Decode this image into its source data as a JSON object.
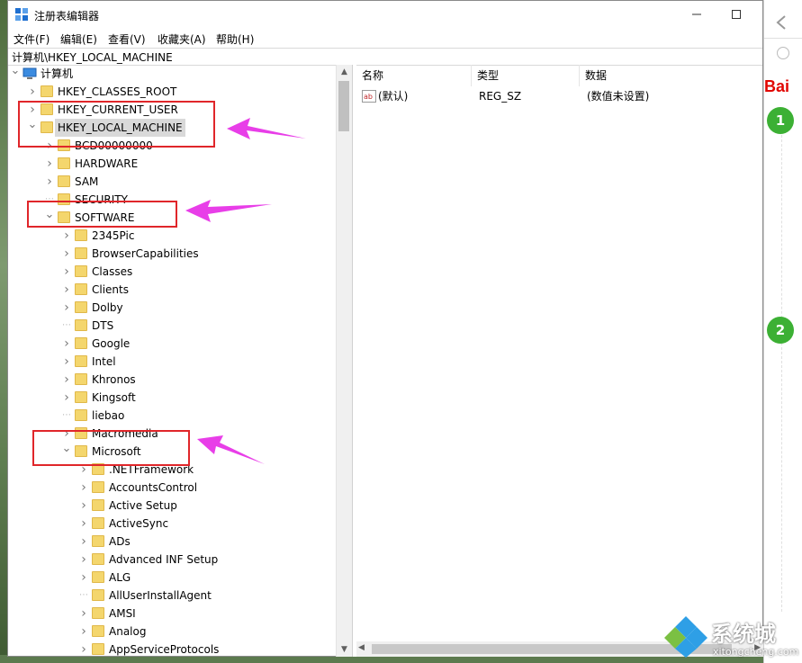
{
  "window": {
    "title": "注册表编辑器",
    "minimize_icon": "minimize-icon",
    "maximize_icon": "maximize-icon"
  },
  "menu": [
    "文件(F)",
    "编辑(E)",
    "查看(V)",
    "收藏夹(A)",
    "帮助(H)"
  ],
  "address": "计算机\\HKEY_LOCAL_MACHINE",
  "columns": {
    "name": "名称",
    "type": "类型",
    "data": "数据"
  },
  "values": [
    {
      "name": "(默认)",
      "type": "REG_SZ",
      "data": "(数值未设置)",
      "icon": "string-value-icon"
    }
  ],
  "tree": [
    {
      "label": "计算机",
      "level": 0,
      "expander": "expanded",
      "icon": "computer-icon"
    },
    {
      "label": "HKEY_CLASSES_ROOT",
      "level": 1,
      "expander": "collapsed"
    },
    {
      "label": "HKEY_CURRENT_USER",
      "level": 1,
      "expander": "collapsed"
    },
    {
      "label": "HKEY_LOCAL_MACHINE",
      "level": 1,
      "expander": "expanded",
      "selected": true
    },
    {
      "label": "BCD00000000",
      "level": 2,
      "expander": "collapsed"
    },
    {
      "label": "HARDWARE",
      "level": 2,
      "expander": "collapsed"
    },
    {
      "label": "SAM",
      "level": 2,
      "expander": "collapsed"
    },
    {
      "label": "SECURITY",
      "level": 2,
      "expander": "none"
    },
    {
      "label": "SOFTWARE",
      "level": 2,
      "expander": "expanded"
    },
    {
      "label": "2345Pic",
      "level": 3,
      "expander": "collapsed"
    },
    {
      "label": "BrowserCapabilities",
      "level": 3,
      "expander": "collapsed"
    },
    {
      "label": "Classes",
      "level": 3,
      "expander": "collapsed"
    },
    {
      "label": "Clients",
      "level": 3,
      "expander": "collapsed"
    },
    {
      "label": "Dolby",
      "level": 3,
      "expander": "collapsed"
    },
    {
      "label": "DTS",
      "level": 3,
      "expander": "none"
    },
    {
      "label": "Google",
      "level": 3,
      "expander": "collapsed"
    },
    {
      "label": "Intel",
      "level": 3,
      "expander": "collapsed"
    },
    {
      "label": "Khronos",
      "level": 3,
      "expander": "collapsed"
    },
    {
      "label": "Kingsoft",
      "level": 3,
      "expander": "collapsed"
    },
    {
      "label": "liebao",
      "level": 3,
      "expander": "none"
    },
    {
      "label": "Macromedia",
      "level": 3,
      "expander": "collapsed"
    },
    {
      "label": "Microsoft",
      "level": 3,
      "expander": "expanded"
    },
    {
      "label": ".NETFramework",
      "level": 4,
      "expander": "collapsed"
    },
    {
      "label": "AccountsControl",
      "level": 4,
      "expander": "collapsed"
    },
    {
      "label": "Active Setup",
      "level": 4,
      "expander": "collapsed"
    },
    {
      "label": "ActiveSync",
      "level": 4,
      "expander": "collapsed"
    },
    {
      "label": "ADs",
      "level": 4,
      "expander": "collapsed"
    },
    {
      "label": "Advanced INF Setup",
      "level": 4,
      "expander": "collapsed"
    },
    {
      "label": "ALG",
      "level": 4,
      "expander": "collapsed"
    },
    {
      "label": "AllUserInstallAgent",
      "level": 4,
      "expander": "none"
    },
    {
      "label": "AMSI",
      "level": 4,
      "expander": "collapsed"
    },
    {
      "label": "Analog",
      "level": 4,
      "expander": "collapsed"
    },
    {
      "label": "AppServiceProtocols",
      "level": 4,
      "expander": "collapsed"
    }
  ],
  "browser_side": {
    "logo": "Bai",
    "steps": [
      "1",
      "2"
    ],
    "back_icon": "back-arrow-icon"
  },
  "watermark": {
    "text": "系统城",
    "sub": "xitongcheng.com",
    "icon": "diamond-logo-icon"
  },
  "colors": {
    "arrow": "#e83ee8",
    "highlight_box": "#e0262a",
    "step": "#3cb034",
    "folder": "#f4d66d",
    "selection": "#d9d9d9"
  }
}
